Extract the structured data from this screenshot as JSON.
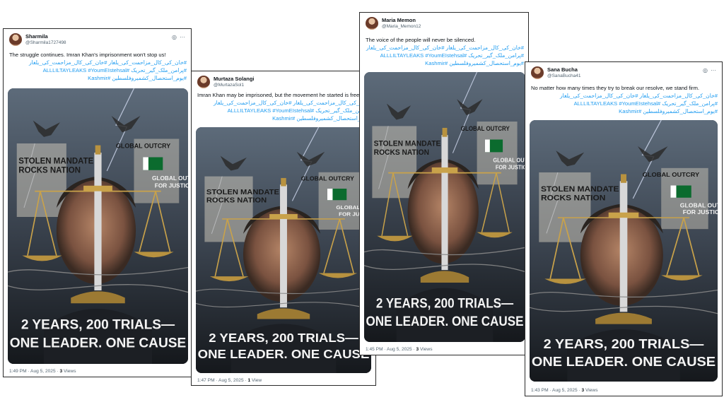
{
  "posts": [
    {
      "name": "Sharmila",
      "handle": "@Sharmila1727498",
      "text": "The struggle continues. Imran Khan's imprisonment won't stop us!",
      "hashtags": [
        "#خان_کی_کال_مزاحمت_کی_یلغار #خان_کی_کال_مزاحمت_کی_یلغار",
        "#پرامن_ملک_گیر_تحریک #ALLLILTAYLEAKS #YoumEIstehsal",
        "#یوم_استحصال_کشمیروفلسطین #Kashmir"
      ],
      "time": "1:49 PM · Aug 5, 2025 ·",
      "views": "3",
      "views_label": "Views"
    },
    {
      "name": "Murtaza Solangi",
      "handle": "@MurtazaSol1",
      "text": "Imran Khan may be imprisoned, but the movement he started is free",
      "hashtags": [
        "#خان_کی_کال_مزاحمت_کی_یلغار #خان_کی_کال_مزاحمت_کی_یلغار",
        "#پرامن_ملک_گیر_تحریک #ALLLILTAYLEAKS #YoumEIstehsal",
        "#یوم_استحصال_کشمیروفلسطین #Kashmir"
      ],
      "time": "1:47 PM · Aug 5, 2025 ·",
      "views": "1",
      "views_label": "View"
    },
    {
      "name": "Maria Memon",
      "handle": "@Maria_Memon12",
      "text": "The voice of the people will never be silenced.",
      "hashtags": [
        "#خان_کی_کال_مزاحمت_کی_یلغار #خان_کی_کال_مزاحمت_کی_یلغار",
        "#پرامن_ملک_گیر_تحریک #ALLLILTAYLEAKS #YoumEIstehsal",
        "#یوم_استحصال_کشمیروفلسطین #Kashmir"
      ],
      "time": "1:45 PM · Aug 5, 2025 ·",
      "views": "3",
      "views_label": "Views"
    },
    {
      "name": "Sana Bucha",
      "handle": "@SanaBucha41",
      "text": "No matter how many times they try to break our resolve, we stand firm.",
      "hashtags": [
        "#خان_کی_کال_مزاحمت_کی_یلغار #خان_کی_کال_مزاحمت_کی_یلغار",
        "#پرامن_ملک_گیر_تحریک #ALLLILTAYLEAKS #YoumEIstehsal",
        "#یوم_استحصال_کشمیروفلسطین #Kashmir"
      ],
      "time": "1:43 PM · Aug 5, 2025 ·",
      "views": "3",
      "views_label": "Views"
    }
  ],
  "poster": {
    "headline1": "STOLEN MANDATE",
    "headline2": "ROCKS NATION",
    "global1": "GLOBAL OUTCRY",
    "global2": "FOR JUSTICE",
    "slogan1": "2 YEARS, 200 TRIALS—",
    "slogan2": "ONE LEADER. ONE CAUSE"
  },
  "icons": {
    "grok": "grok-icon",
    "more": "more-icon"
  },
  "colors": {
    "link": "#1d9bf0",
    "muted": "#536471",
    "border": "#2a2a2a"
  }
}
